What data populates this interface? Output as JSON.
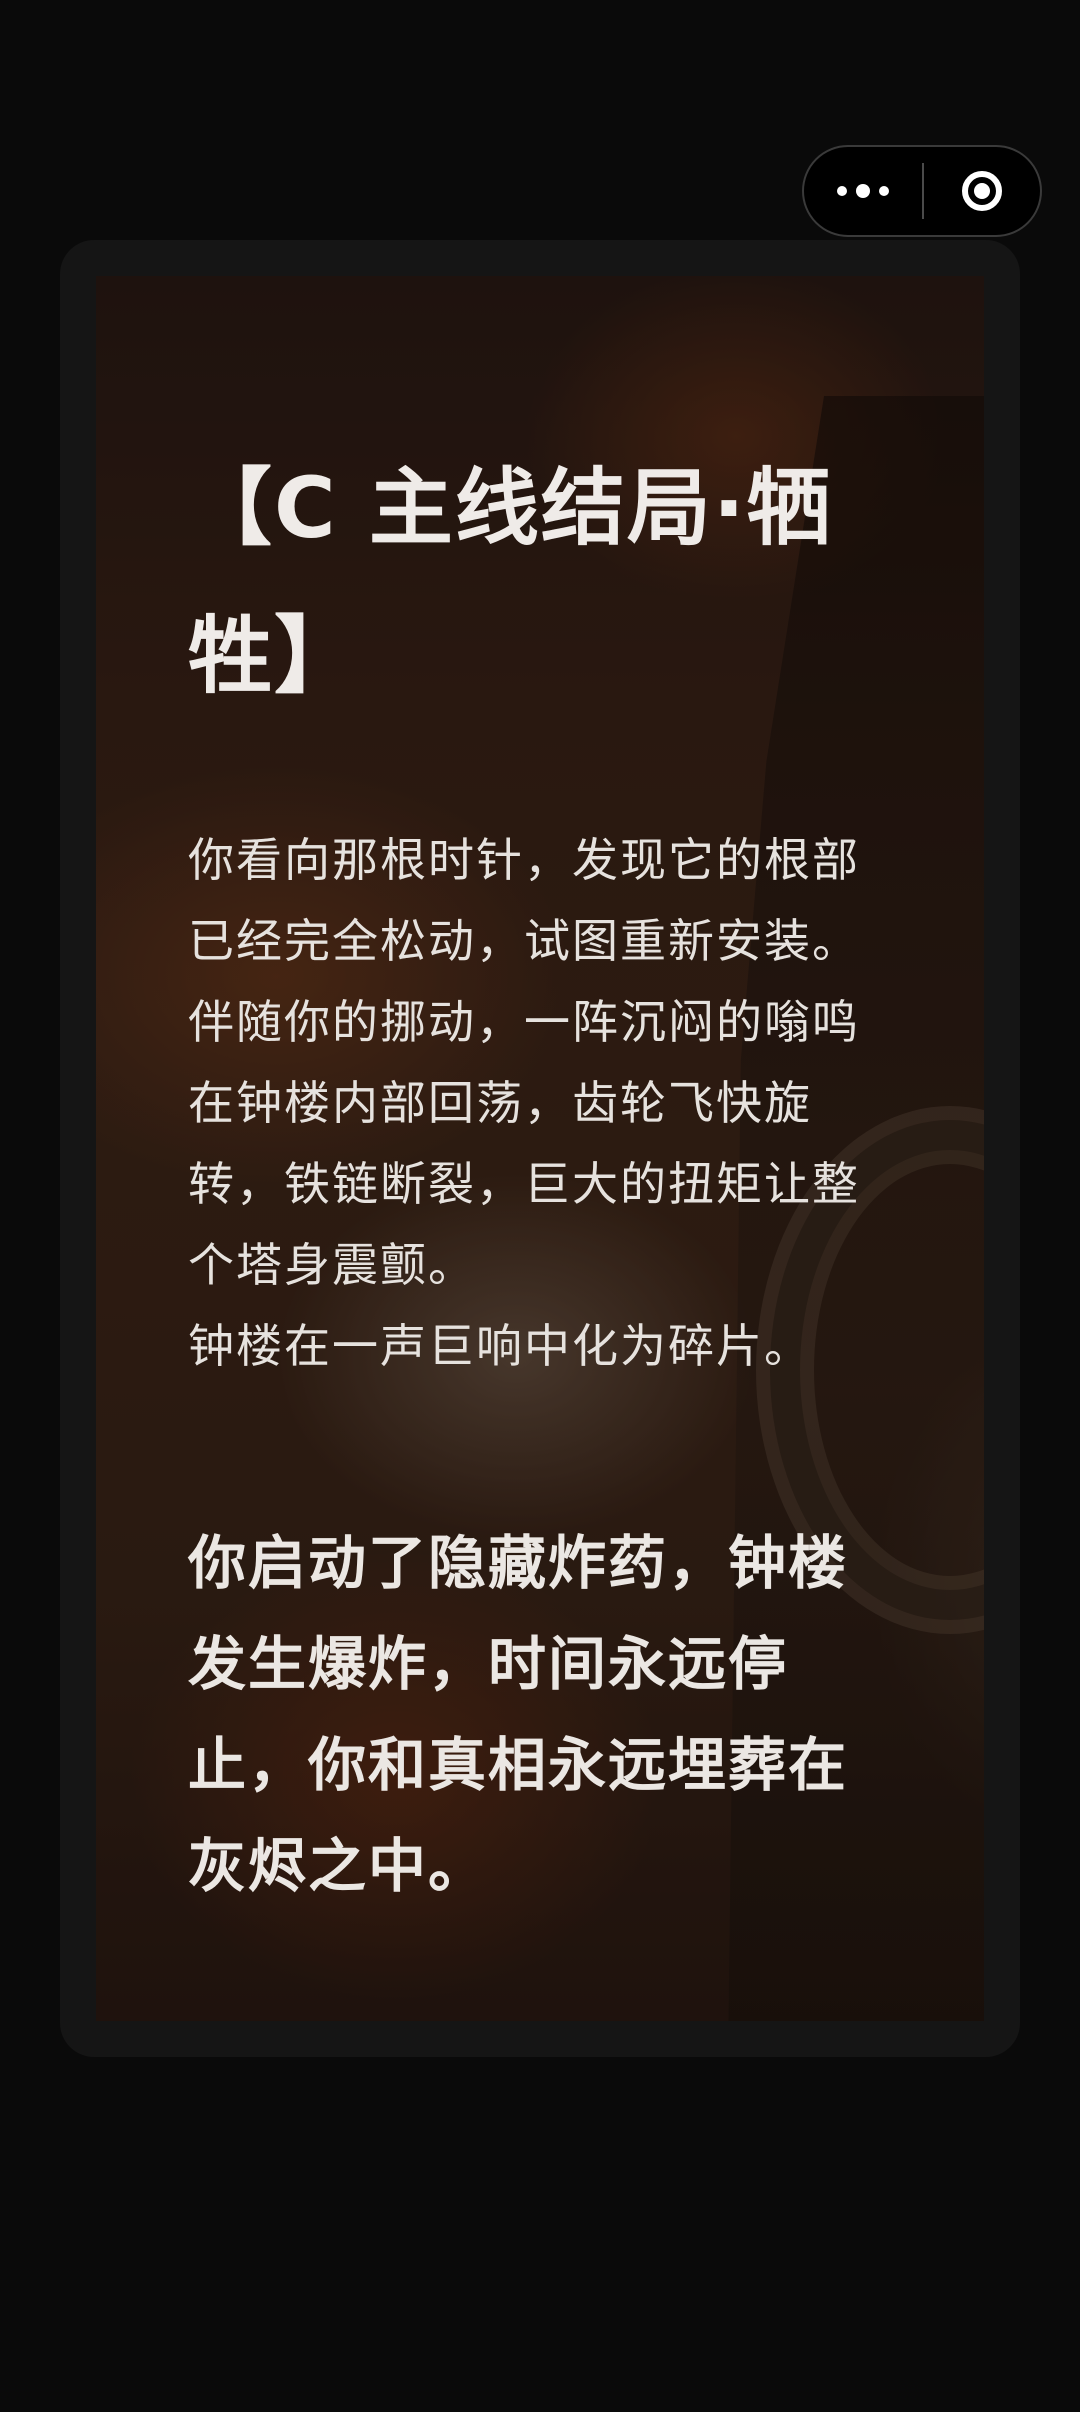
{
  "capsule": {
    "more_icon": "more-dots-icon",
    "close_icon": "target-close-icon"
  },
  "card": {
    "title": "【C 主线结局·牺牲】",
    "paragraphs": [
      "你看向那根时针，发现它的根部已经完全松动，试图重新安装。伴随你的挪动，一阵沉闷的嗡鸣在钟楼内部回荡，齿轮飞快旋转，铁链断裂，巨大的扭矩让整个塔身震颤。",
      "钟楼在一声巨响中化为碎片。"
    ],
    "outcome": "你启动了隐藏炸药，钟楼发生爆炸，时间永远停止，你和真相永远埋葬在灰烬之中。"
  },
  "colors": {
    "page_background": "#0a0a0a",
    "frame": "#151515",
    "text": "#e8e4e1"
  }
}
